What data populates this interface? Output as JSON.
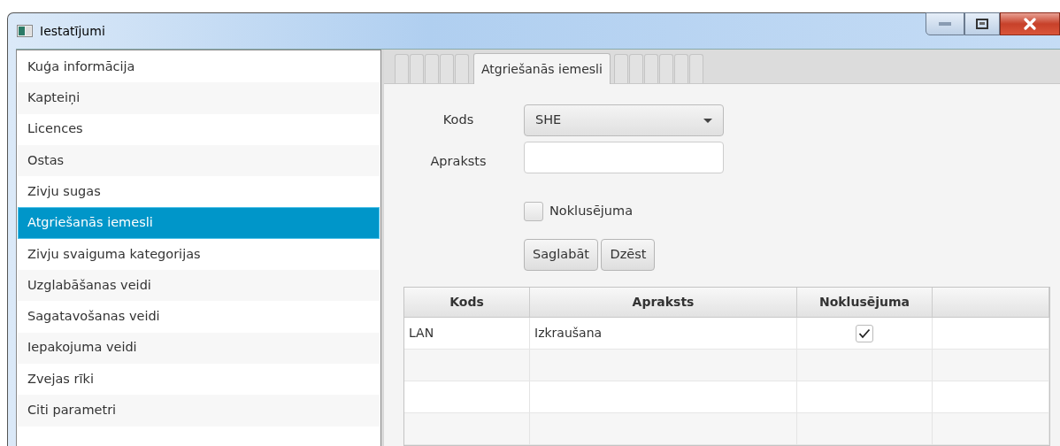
{
  "window": {
    "title": "Iestatījumi"
  },
  "sidebar": {
    "items": [
      {
        "label": "Kuģa informācija",
        "selected": false
      },
      {
        "label": "Kapteiņi",
        "selected": false
      },
      {
        "label": "Licences",
        "selected": false
      },
      {
        "label": "Ostas",
        "selected": false
      },
      {
        "label": "Zivju sugas",
        "selected": false
      },
      {
        "label": "Atgriešanās iemesli",
        "selected": true
      },
      {
        "label": "Zivju svaiguma kategorijas",
        "selected": false
      },
      {
        "label": "Uzglabāšanas veidi",
        "selected": false
      },
      {
        "label": "Sagatavošanas veidi",
        "selected": false
      },
      {
        "label": "Iepakojuma veidi",
        "selected": false
      },
      {
        "label": "Zvejas rīki",
        "selected": false
      },
      {
        "label": "Citi parametri",
        "selected": false
      }
    ]
  },
  "tabs": [
    {
      "selected": false
    },
    {
      "selected": false
    },
    {
      "selected": false
    },
    {
      "selected": false
    },
    {
      "selected": false
    },
    {
      "label": "Atgriešanās iemesli",
      "selected": true
    },
    {
      "selected": false
    },
    {
      "selected": false
    },
    {
      "selected": false
    },
    {
      "selected": false
    },
    {
      "selected": false
    },
    {
      "selected": false
    }
  ],
  "form": {
    "code_label": "Kods",
    "code_value": "SHE",
    "description_label": "Apraksts",
    "default_label": "Noklusējuma",
    "default_checked": false,
    "buttons": [
      "Saglabāt",
      "Dzēst"
    ]
  },
  "table": {
    "columns": [
      "Kods",
      "Apraksts",
      "Noklusējuma"
    ],
    "rows": [
      {
        "code": "LAN",
        "description": "Izkraušana",
        "default": true
      }
    ]
  }
}
